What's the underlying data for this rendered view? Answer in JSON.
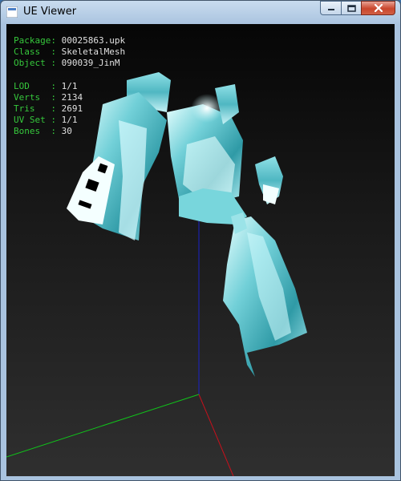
{
  "window": {
    "title": "UE Viewer",
    "controls": {
      "minimize": "minimize-icon",
      "maximize": "maximize-icon",
      "close": "close-icon"
    }
  },
  "info": {
    "package_label": "Package: ",
    "package": "00025863.upk",
    "class_label": "Class  : ",
    "class": "SkeletalMesh",
    "object_label": "Object : ",
    "object": "090039_JinM",
    "lod_label": "LOD    : ",
    "lod": "1/1",
    "verts_label": "Verts  : ",
    "verts": "2134",
    "tris_label": "Tris   : ",
    "tris": "2691",
    "uvset_label": "UV Set : ",
    "uvset": "1/1",
    "bones_label": "Bones  : ",
    "bones": "30"
  },
  "colors": {
    "label": "#36c83c",
    "value": "#e0e0e0",
    "axis_x": "#c8101c",
    "axis_y": "#10c41a",
    "axis_z": "#1a22c8",
    "mesh": "#6fd2d8"
  }
}
